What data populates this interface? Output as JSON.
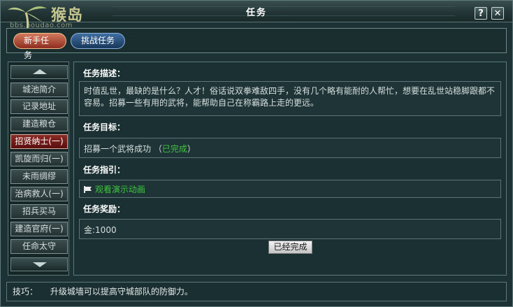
{
  "window": {
    "title": "任务",
    "help_label": "?",
    "close_label": "✕"
  },
  "logo": {
    "brand": "猴岛",
    "url": "bbs.houdao.com"
  },
  "tabs": [
    {
      "label": "新手任务"
    },
    {
      "label": "挑战任务"
    }
  ],
  "nav": {
    "items": [
      {
        "label": "城池简介"
      },
      {
        "label": "记录地址"
      },
      {
        "label": "建造粮仓"
      },
      {
        "label": "招贤纳士(一)",
        "active": true
      },
      {
        "label": "凯旋而归(一)"
      },
      {
        "label": "未雨绸缪"
      },
      {
        "label": "治病救人(一)"
      },
      {
        "label": "招兵买马"
      },
      {
        "label": "建造官府(一)"
      },
      {
        "label": "任命太守"
      }
    ]
  },
  "task": {
    "desc_label": "任务描述：",
    "desc_text": "时值乱世，最缺的是什么？人才！俗话说双拳难敌四手，没有几个略有能耐的人帮忙，想要在乱世站稳脚跟都不容易。招募一些有用的武将，能帮助自己在称霸路上走的更远。",
    "goal_label": "任务目标：",
    "goal_text": "招募一个武将成功",
    "goal_status_open": "（",
    "goal_status": "已完成",
    "goal_status_close": "）",
    "guide_label": "任务指引：",
    "guide_link": "观看演示动画",
    "reward_label": "任务奖励：",
    "reward_text": "金:1000",
    "done_button": "已经完成"
  },
  "tip": {
    "label": "技巧：",
    "text": "升级城墙可以提高守城部队的防御力。"
  },
  "colors": {
    "accent_green": "#3ec43e",
    "active_tab_red": "#8a2a25",
    "panel_bg": "#1d3234"
  },
  "icons": {
    "scroll_up": "triangle-up-icon",
    "scroll_down": "triangle-down-icon",
    "guide": "flag-icon"
  }
}
